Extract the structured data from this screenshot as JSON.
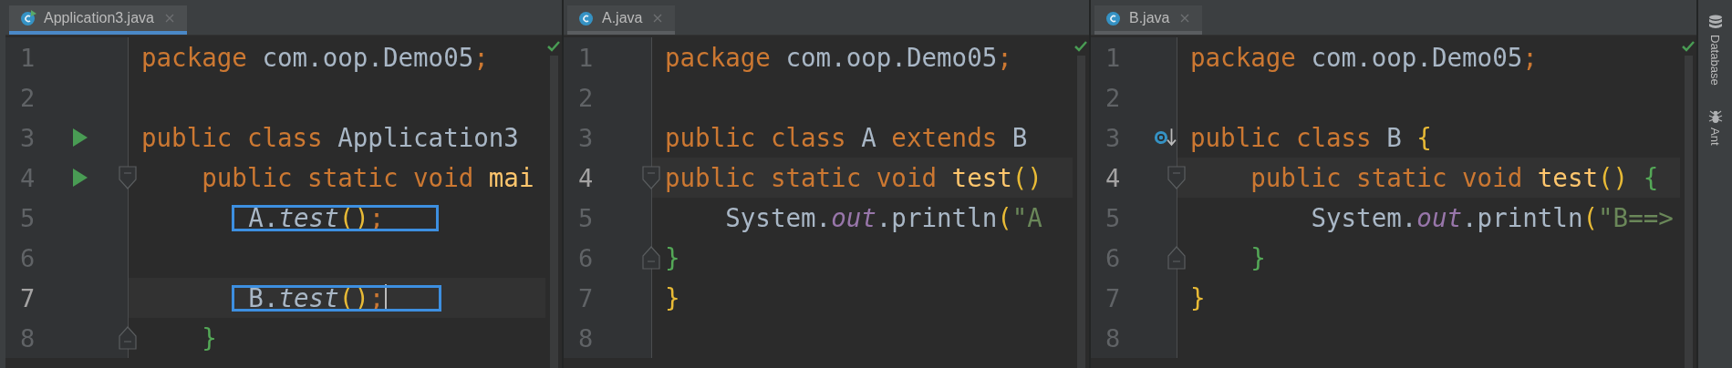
{
  "panes": [
    {
      "tab": {
        "label": "Application3.java",
        "focused": true,
        "runnable": true
      },
      "lines": [
        {
          "number": "1",
          "current": false,
          "tokens": [
            {
              "kind": "keyword",
              "text": "package "
            },
            {
              "kind": "plain",
              "text": "com.oop.Demo05"
            },
            {
              "kind": "semicolon",
              "text": ";"
            }
          ]
        },
        {
          "number": "2",
          "current": false
        },
        {
          "number": "3",
          "current": false,
          "run_marker": true,
          "tokens": [
            {
              "kind": "keyword",
              "text": "public class "
            },
            {
              "kind": "plain",
              "text": "Application3"
            }
          ]
        },
        {
          "number": "4",
          "current": false,
          "run_marker": true,
          "fold_start": true,
          "tokens": [
            {
              "kind": "keyword",
              "text": "    public static void "
            },
            {
              "kind": "method",
              "text": "mai"
            }
          ]
        },
        {
          "number": "5",
          "current": false,
          "boxed": true,
          "tokens": [
            {
              "kind": "plain",
              "text": "      A."
            },
            {
              "kind": "static-call",
              "text": "test"
            },
            {
              "kind": "bracket",
              "color": "#e8ba36",
              "text": "()"
            },
            {
              "kind": "semicolon",
              "text": ";"
            }
          ]
        },
        {
          "number": "6",
          "current": false
        },
        {
          "number": "7",
          "current": true,
          "boxed": true,
          "caret": true,
          "tokens": [
            {
              "kind": "plain",
              "text": "      B."
            },
            {
              "kind": "static-call",
              "text": "test"
            },
            {
              "kind": "bracket",
              "color": "#e8ba36",
              "text": "()"
            },
            {
              "kind": "semicolon",
              "text": ";"
            }
          ]
        },
        {
          "number": "8",
          "current": false,
          "fold_end": true,
          "tokens": [
            {
              "kind": "bracket",
              "color": "#54a857",
              "text": "    }"
            }
          ]
        }
      ]
    },
    {
      "tab": {
        "label": "A.java",
        "focused": false,
        "runnable": false
      },
      "lines": [
        {
          "number": "1",
          "current": false,
          "tokens": [
            {
              "kind": "keyword",
              "text": "package "
            },
            {
              "kind": "plain",
              "text": "com.oop.Demo05"
            },
            {
              "kind": "semicolon",
              "text": ";"
            }
          ]
        },
        {
          "number": "2",
          "current": false
        },
        {
          "number": "3",
          "current": false,
          "tokens": [
            {
              "kind": "keyword",
              "text": "public class "
            },
            {
              "kind": "plain",
              "text": "A "
            },
            {
              "kind": "keyword",
              "text": "extends "
            },
            {
              "kind": "plain",
              "text": "B"
            }
          ]
        },
        {
          "number": "4",
          "current": true,
          "fold_start": true,
          "tokens": [
            {
              "kind": "keyword",
              "text": "public static void "
            },
            {
              "kind": "method",
              "text": "test"
            },
            {
              "kind": "bracket",
              "color": "#e8ba36",
              "text": "()"
            }
          ]
        },
        {
          "number": "5",
          "current": false,
          "tokens": [
            {
              "kind": "plain",
              "text": "    System."
            },
            {
              "kind": "static-field",
              "text": "out"
            },
            {
              "kind": "plain",
              "text": ".println"
            },
            {
              "kind": "bracket",
              "color": "#e8ba36",
              "text": "("
            },
            {
              "kind": "string",
              "text": "\"A"
            }
          ]
        },
        {
          "number": "6",
          "current": false,
          "fold_end": true,
          "tokens": [
            {
              "kind": "bracket",
              "color": "#54a857",
              "text": "}"
            }
          ]
        },
        {
          "number": "7",
          "current": false,
          "tokens": [
            {
              "kind": "bracket",
              "color": "#e8ba36",
              "text": "}"
            }
          ]
        },
        {
          "number": "8",
          "current": false
        }
      ]
    },
    {
      "tab": {
        "label": "B.java",
        "focused": false,
        "runnable": false
      },
      "lines": [
        {
          "number": "1",
          "current": false,
          "tokens": [
            {
              "kind": "keyword",
              "text": "package "
            },
            {
              "kind": "plain",
              "text": "com.oop.Demo05"
            },
            {
              "kind": "semicolon",
              "text": ";"
            }
          ]
        },
        {
          "number": "2",
          "current": false
        },
        {
          "number": "3",
          "current": false,
          "override_marker": true,
          "tokens": [
            {
              "kind": "keyword",
              "text": "public class "
            },
            {
              "kind": "plain",
              "text": "B "
            },
            {
              "kind": "bracket",
              "color": "#e8ba36",
              "text": "{"
            }
          ]
        },
        {
          "number": "4",
          "current": true,
          "fold_start": true,
          "tokens": [
            {
              "kind": "keyword",
              "text": "    public static void "
            },
            {
              "kind": "method",
              "text": "test"
            },
            {
              "kind": "bracket",
              "color": "#e8ba36",
              "text": "() "
            },
            {
              "kind": "bracket",
              "color": "#54a857",
              "text": "{"
            }
          ]
        },
        {
          "number": "5",
          "current": false,
          "tokens": [
            {
              "kind": "plain",
              "text": "        System."
            },
            {
              "kind": "static-field",
              "text": "out"
            },
            {
              "kind": "plain",
              "text": ".println"
            },
            {
              "kind": "bracket",
              "color": "#e8ba36",
              "text": "("
            },
            {
              "kind": "string",
              "text": "\"B==>"
            }
          ]
        },
        {
          "number": "6",
          "current": false,
          "fold_end": true,
          "tokens": [
            {
              "kind": "bracket",
              "color": "#54a857",
              "text": "    }"
            }
          ]
        },
        {
          "number": "7",
          "current": false,
          "tokens": [
            {
              "kind": "bracket",
              "color": "#e8ba36",
              "text": "}"
            }
          ]
        },
        {
          "number": "8",
          "current": false
        }
      ]
    }
  ],
  "tool_windows": [
    {
      "kind": "database",
      "label": "Database"
    },
    {
      "kind": "ant",
      "label": "Ant"
    }
  ]
}
